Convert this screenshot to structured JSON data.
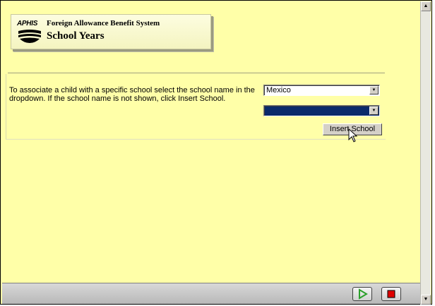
{
  "header": {
    "logo_text": "APHIS",
    "title": "Foreign Allowance Benefit System",
    "subtitle": "School Years"
  },
  "form": {
    "instructions": "To associate a child with a specific school select the school name in the dropdown. If the school name is not shown, click Insert School.",
    "country_select_value": "Mexico",
    "school_select_value": "",
    "insert_button_label": "Insert School"
  },
  "icons": {
    "logo": "aphis-logo-icon",
    "play": "play-icon",
    "stop": "stop-icon",
    "cursor": "mouse-cursor-icon",
    "dropdown_arrow": "chevron-down-icon"
  },
  "colors": {
    "background": "#ffffa8",
    "selected_highlight": "#0a2a6a",
    "play_icon": "#2ca02c",
    "stop_icon": "#e00000"
  }
}
